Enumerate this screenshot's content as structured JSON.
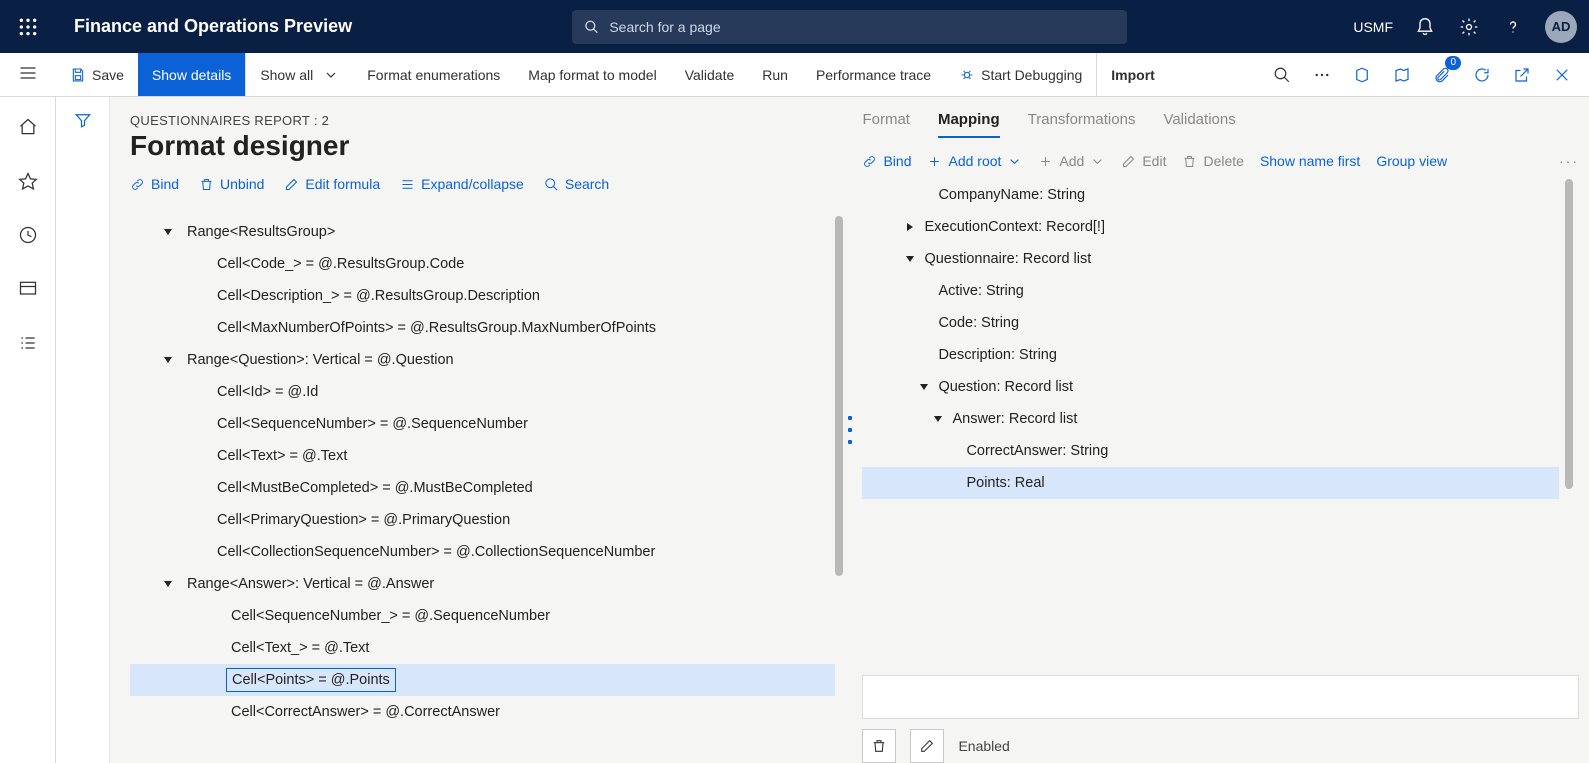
{
  "header": {
    "brand": "Finance and Operations Preview",
    "search_placeholder": "Search for a page",
    "legal_entity": "USMF",
    "avatar_initials": "AD"
  },
  "toolbar": {
    "save": "Save",
    "show_details": "Show details",
    "show_all": "Show all",
    "format_enum": "Format enumerations",
    "map_format": "Map format to model",
    "validate": "Validate",
    "run": "Run",
    "perf_trace": "Performance trace",
    "start_debug": "Start Debugging",
    "import": "Import",
    "attachments_count": "0"
  },
  "page": {
    "breadcrumb": "QUESTIONNAIRES REPORT : 2",
    "title": "Format designer"
  },
  "left_toolbar": {
    "bind": "Bind",
    "unbind": "Unbind",
    "edit_formula": "Edit formula",
    "expand_collapse": "Expand/collapse",
    "search": "Search"
  },
  "format_tree": [
    {
      "indent": 0,
      "expanded": true,
      "label": "Range<ResultsGroup>"
    },
    {
      "indent": 1,
      "expanded": null,
      "label": "Cell<Code_> = @.ResultsGroup.Code"
    },
    {
      "indent": 1,
      "expanded": null,
      "label": "Cell<Description_> = @.ResultsGroup.Description"
    },
    {
      "indent": 1,
      "expanded": null,
      "label": "Cell<MaxNumberOfPoints> = @.ResultsGroup.MaxNumberOfPoints"
    },
    {
      "indent": 0,
      "expanded": true,
      "label": "Range<Question>: Vertical = @.Question"
    },
    {
      "indent": 1,
      "expanded": null,
      "label": "Cell<Id> = @.Id"
    },
    {
      "indent": 1,
      "expanded": null,
      "label": "Cell<SequenceNumber> = @.SequenceNumber"
    },
    {
      "indent": 1,
      "expanded": null,
      "label": "Cell<Text> = @.Text"
    },
    {
      "indent": 1,
      "expanded": null,
      "label": "Cell<MustBeCompleted> = @.MustBeCompleted"
    },
    {
      "indent": 1,
      "expanded": null,
      "label": "Cell<PrimaryQuestion> = @.PrimaryQuestion"
    },
    {
      "indent": 1,
      "expanded": null,
      "label": "Cell<CollectionSequenceNumber> = @.CollectionSequenceNumber"
    },
    {
      "indent": 0,
      "expanded": true,
      "label": "Range<Answer>: Vertical = @.Answer"
    },
    {
      "indent": 2,
      "expanded": null,
      "label": "Cell<SequenceNumber_> = @.SequenceNumber"
    },
    {
      "indent": 2,
      "expanded": null,
      "label": "Cell<Text_> = @.Text"
    },
    {
      "indent": 2,
      "expanded": null,
      "label": "Cell<Points> = @.Points",
      "selected": true
    },
    {
      "indent": 2,
      "expanded": null,
      "label": "Cell<CorrectAnswer> = @.CorrectAnswer"
    }
  ],
  "right_tabs": {
    "format": "Format",
    "mapping": "Mapping",
    "transformations": "Transformations",
    "validations": "Validations"
  },
  "right_toolbar": {
    "bind": "Bind",
    "add_root": "Add root",
    "add": "Add",
    "edit": "Edit",
    "delete": "Delete",
    "show_name_first": "Show name first",
    "group_view": "Group view"
  },
  "mapping_tree": [
    {
      "indent": 1,
      "tri": "none",
      "label": "CompanyName: String"
    },
    {
      "indent": 0,
      "tri": "right",
      "label": "ExecutionContext: Record[!]"
    },
    {
      "indent": 0,
      "tri": "down",
      "label": "Questionnaire: Record list"
    },
    {
      "indent": 1,
      "tri": "none",
      "label": "Active: String"
    },
    {
      "indent": 1,
      "tri": "none",
      "label": "Code: String"
    },
    {
      "indent": 1,
      "tri": "none",
      "label": "Description: String"
    },
    {
      "indent": 1,
      "tri": "down",
      "label": "Question: Record list"
    },
    {
      "indent": 2,
      "tri": "down",
      "label": "Answer: Record list"
    },
    {
      "indent": 3,
      "tri": "none",
      "label": "CorrectAnswer: String"
    },
    {
      "indent": 3,
      "tri": "none",
      "label": "Points: Real",
      "selected": true
    }
  ],
  "enabled_label": "Enabled"
}
